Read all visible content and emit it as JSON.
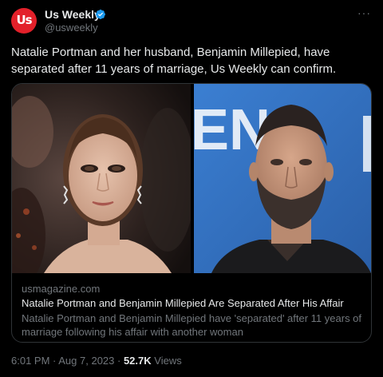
{
  "account": {
    "name": "Us Weekly",
    "handle": "@usweekly",
    "avatar_text": "Us",
    "verified": true
  },
  "menu": {
    "more_label": "···"
  },
  "tweet": {
    "text": "Natalie Portman and her husband, Benjamin Millepied, have separated after 11 years of marriage, Us Weekly can confirm."
  },
  "card": {
    "domain": "usmagazine.com",
    "title": "Natalie Portman and Benjamin Millepied Are Separated After His Affair",
    "description": "Natalie Portman and Benjamin Millepied have 'separated' after 11 years of marriage following his affair with another woman",
    "backdrop_letters": "EN"
  },
  "meta": {
    "time": "6:01 PM",
    "separator": " · ",
    "date": "Aug 7, 2023",
    "views_count": "52.7K",
    "views_label": " Views"
  },
  "colors": {
    "background": "#000000",
    "text": "#e7e9ea",
    "secondary": "#71767b",
    "verified": "#1d9bf0",
    "avatar": "#e3202a",
    "border": "#2f3336"
  }
}
